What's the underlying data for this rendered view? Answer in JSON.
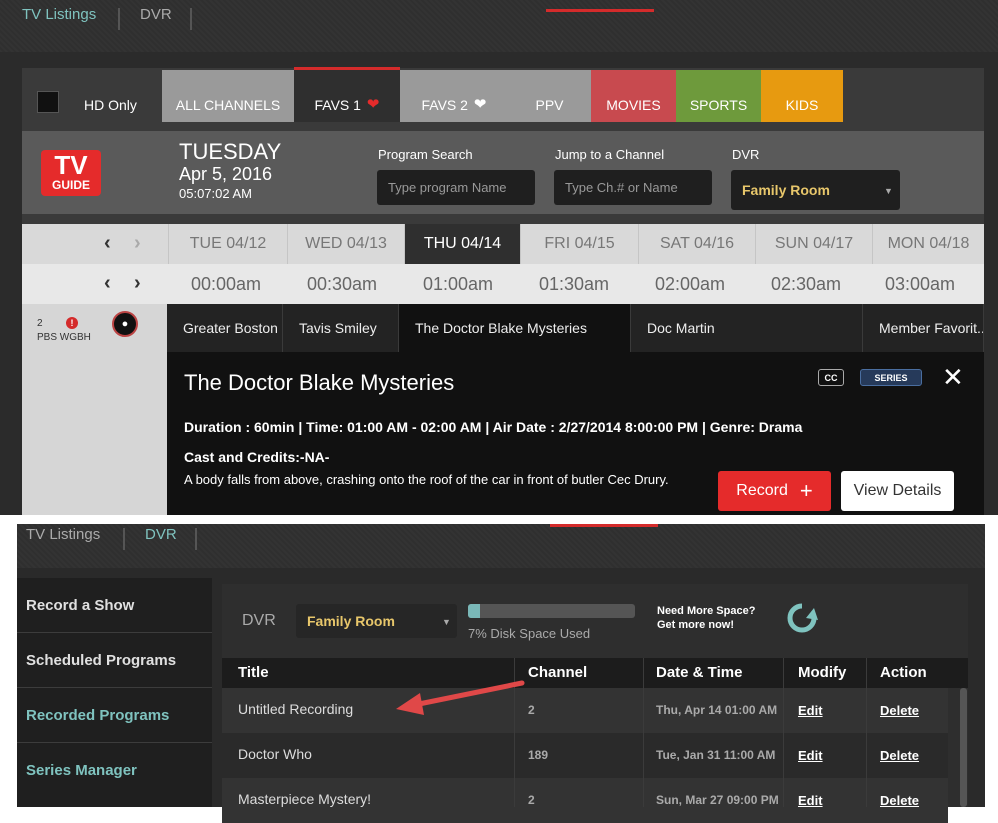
{
  "top": {
    "nav": {
      "tv_listings": "TV Listings",
      "dvr": "DVR"
    },
    "hd_only": "HD Only",
    "categories": [
      {
        "label": "ALL CHANNELS",
        "color": "#9a9a9a"
      },
      {
        "label": "FAVS 1",
        "color": "#2f2f2f"
      },
      {
        "label": "FAVS 2",
        "color": "#9a9a9a"
      },
      {
        "label": "PPV",
        "color": "#9a9a9a"
      },
      {
        "label": "MOVIES",
        "color": "#c84a4f"
      },
      {
        "label": "SPORTS",
        "color": "#6e9a3c"
      },
      {
        "label": "KIDS",
        "color": "#e79a10"
      }
    ],
    "logo": {
      "line1": "TV",
      "line2": "GUIDE"
    },
    "date": {
      "day": "TUESDAY",
      "date": "Apr 5, 2016",
      "time": "05:07:02 AM"
    },
    "program_search": {
      "label": "Program Search",
      "placeholder": "Type program Name"
    },
    "jump_channel": {
      "label": "Jump to a Channel",
      "placeholder": "Type Ch.# or Name"
    },
    "dvr": {
      "label": "DVR",
      "value": "Family Room"
    },
    "days": [
      "TUE 04/12",
      "WED 04/13",
      "THU 04/14",
      "FRI 04/15",
      "SAT 04/16",
      "SUN 04/17",
      "MON 04/18"
    ],
    "times": [
      "00:00am",
      "00:30am",
      "01:00am",
      "01:30am",
      "02:00am",
      "02:30am",
      "03:00am"
    ],
    "channel": {
      "number": "2",
      "alert": "!",
      "name": "PBS WGBH"
    },
    "programs": [
      "Greater Boston",
      "Tavis Smiley",
      "The Doctor Blake Mysteries",
      "Doc Martin",
      "Member Favorit..."
    ],
    "detail": {
      "title": "The Doctor Blake Mysteries",
      "badge_cc": "CC",
      "badge_series": "SERIES",
      "info": "Duration : 60min | Time: 01:00 AM - 02:00 AM | Air Date : 2/27/2014 8:00:00 PM | Genre: Drama",
      "cast": "Cast and Credits:-NA-",
      "description": "A body falls from above, crashing onto the roof of the car in front of butler Cec Drury.",
      "record": "Record",
      "view_details": "View Details"
    }
  },
  "bottom": {
    "nav": {
      "tv_listings": "TV Listings",
      "dvr": "DVR"
    },
    "sidebar": [
      {
        "label": "Record a Show",
        "color": "#e0e0e0"
      },
      {
        "label": "Scheduled Programs",
        "color": "#e0e0e0"
      },
      {
        "label": "Recorded Programs",
        "color": "#7fc3bf"
      },
      {
        "label": "Series Manager",
        "color": "#7fc3bf"
      }
    ],
    "dvr_label": "DVR",
    "dvr_select": "Family Room",
    "disk_used": 0.07,
    "disk_text": "7% Disk Space Used",
    "need_more_1": "Need More Space?",
    "need_more_2": "Get more now!",
    "columns": [
      "Title",
      "Channel",
      "Date & Time",
      "Modify",
      "Action"
    ],
    "rows": [
      {
        "title": "Untitled Recording",
        "channel": "2",
        "datetime": "Thu, Apr 14 01:00 AM",
        "modify": "Edit",
        "action": "Delete"
      },
      {
        "title": "Doctor Who",
        "channel": "189",
        "datetime": "Tue, Jan 31 11:00 AM",
        "modify": "Edit",
        "action": "Delete"
      },
      {
        "title": "Masterpiece Mystery!",
        "channel": "2",
        "datetime": "Sun, Mar 27 09:00 PM",
        "modify": "Edit",
        "action": "Delete"
      }
    ]
  }
}
